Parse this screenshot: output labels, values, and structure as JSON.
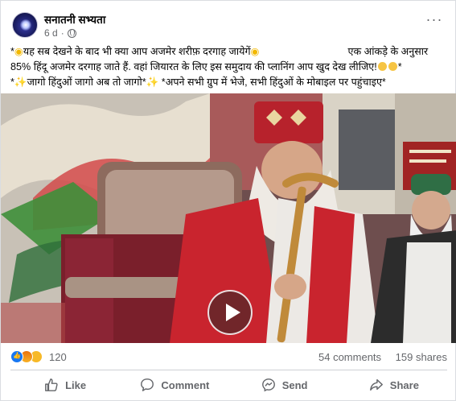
{
  "post": {
    "page_name": "सनातनी सभ्यता",
    "time": "6 d",
    "text_lines": {
      "line1_a": "*",
      "line1_b": "यह सब देखने के बाद भी क्या आप अजमेर शरीफ़ दरगाह जायेगें",
      "line1_c": "एक आंकड़े के अनुसार",
      "line2": "85% हिंदू  अजमेर दरगाह जाते हैं. वहां जियारत के लिए इस समुदाय की प्लानिंग आप खुद देख लीजिए!",
      "line2_end": "*",
      "line3_a": "*",
      "line3_b": "जागो हिंदुओं जागो अब तो जागो*",
      "line3_c": "  *अपने सभी ग्रुप में भेजे, सभी हिंदुओं के मोबाइल पर पहुंचाइए*"
    }
  },
  "stats": {
    "reaction_count": "120",
    "comments": "54 comments",
    "shares": "159 shares"
  },
  "actions": {
    "like": "Like",
    "comment": "Comment",
    "send": "Send",
    "share": "Share"
  },
  "colors": {
    "accent": "#1877f2",
    "secondary_text": "#65676b"
  },
  "icons": [
    "globe-icon",
    "more-icon",
    "play-icon",
    "like-icon",
    "comment-icon",
    "messenger-icon",
    "share-icon"
  ]
}
